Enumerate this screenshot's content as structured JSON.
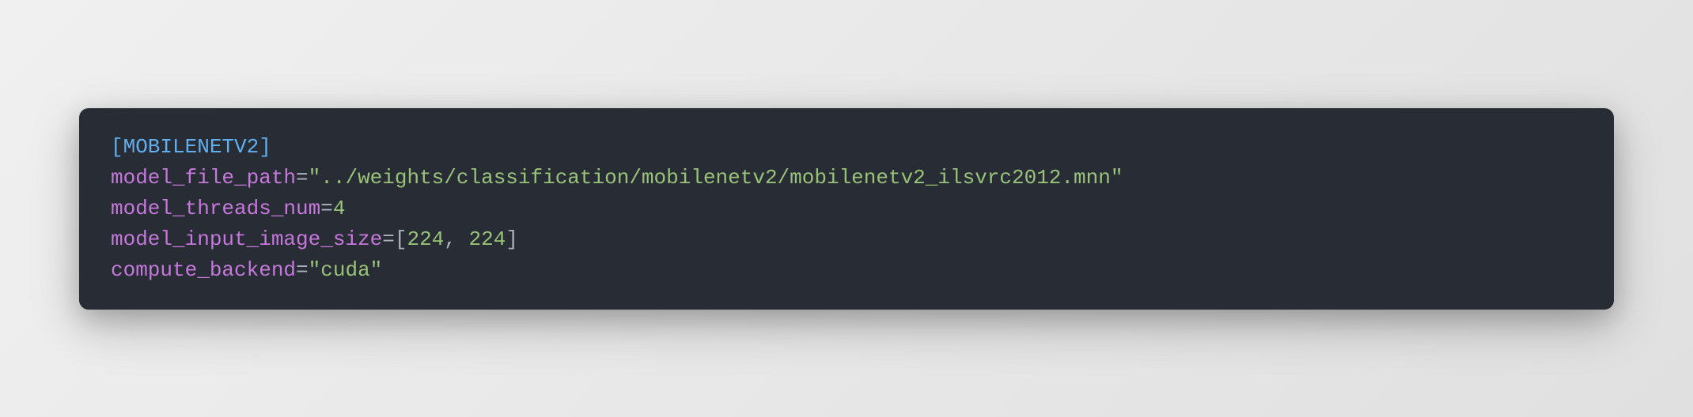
{
  "config": {
    "section_name": "[MOBILENETV2]",
    "lines": [
      {
        "key": "model_file_path",
        "value": "\"../weights/classification/mobilenetv2/mobilenetv2_ilsvrc2012.mnn\"",
        "type": "string"
      },
      {
        "key": "model_threads_num",
        "value": "4",
        "type": "number"
      },
      {
        "key": "model_input_image_size",
        "value_open": "[",
        "value_num1": "224",
        "value_sep": ", ",
        "value_num2": "224",
        "value_close": "]",
        "type": "array"
      },
      {
        "key": "compute_backend",
        "value": "\"cuda\"",
        "type": "string"
      }
    ]
  }
}
